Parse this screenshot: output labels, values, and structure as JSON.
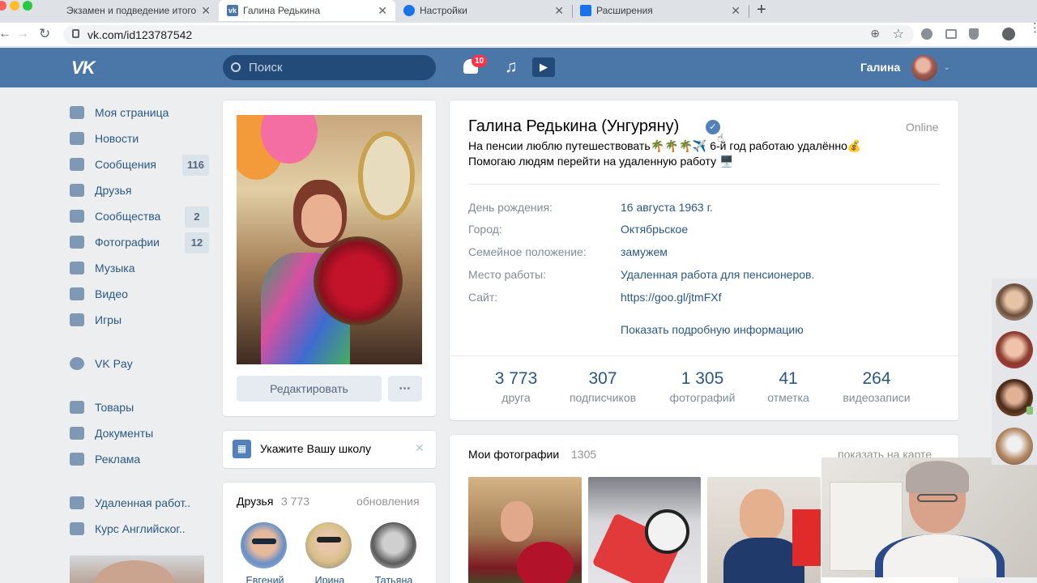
{
  "browser": {
    "tabs": [
      {
        "label": "Экзамен и подведение итогов"
      },
      {
        "label": "Галина Редькина"
      },
      {
        "label": "Настройки"
      },
      {
        "label": "Расширения"
      }
    ],
    "new_tab": "+",
    "url": "vk.com/id123787542"
  },
  "header": {
    "search_placeholder": "Поиск",
    "notifications": "10",
    "user_name": "Галина"
  },
  "menu": [
    {
      "label": "Моя страница",
      "icon": "home-icon"
    },
    {
      "label": "Новости",
      "icon": "news-icon"
    },
    {
      "label": "Сообщения",
      "icon": "messages-icon",
      "count": "116"
    },
    {
      "label": "Друзья",
      "icon": "friends-icon"
    },
    {
      "label": "Сообщества",
      "icon": "groups-icon",
      "count": "2"
    },
    {
      "label": "Фотографии",
      "icon": "camera-icon",
      "count": "12"
    },
    {
      "label": "Музыка",
      "icon": "music-icon"
    },
    {
      "label": "Видео",
      "icon": "video-icon"
    },
    {
      "label": "Игры",
      "icon": "games-icon"
    }
  ],
  "menu2": [
    {
      "label": "VK Pay",
      "icon": "vkpay-icon"
    }
  ],
  "menu3": [
    {
      "label": "Товары",
      "icon": "goods-icon"
    },
    {
      "label": "Документы",
      "icon": "docs-icon"
    },
    {
      "label": "Реклама",
      "icon": "ads-icon"
    }
  ],
  "menu4": [
    {
      "label": "Удаленная работ..",
      "icon": "group-icon"
    },
    {
      "label": "Курс Английског..",
      "icon": "group-icon"
    }
  ],
  "profile": {
    "edit_button": "Редактировать",
    "more_button": "•••",
    "school_prompt": "Укажите Вашу школу",
    "name": "Галина Редькина (Унгуряну)",
    "status_online": "Online",
    "status_line1": "На пенсии люблю путешествовать🌴🌴🌴✈️ 6-й год работаю удалённо💰",
    "status_line2": "Помогаю людям перейти на удаленную работу 🖥️",
    "info": [
      {
        "label": "День рождения:",
        "value": "16 августа 1963 г."
      },
      {
        "label": "Город:",
        "value": "Октябрьское"
      },
      {
        "label": "Семейное положение:",
        "value": "замужем"
      },
      {
        "label": "Место работы:",
        "value": "Удаленная работа для пенсионеров."
      },
      {
        "label": "Сайт:",
        "value": "https://goo.gl/jtmFXf"
      }
    ],
    "more_info": "Показать подробную информацию",
    "stats": [
      {
        "n": "3 773",
        "t": "друга"
      },
      {
        "n": "307",
        "t": "подписчиков"
      },
      {
        "n": "1 305",
        "t": "фотографий"
      },
      {
        "n": "41",
        "t": "отметка"
      },
      {
        "n": "264",
        "t": "видеозаписи"
      }
    ]
  },
  "friends": {
    "title": "Друзья",
    "count": "3 773",
    "updates": "обновления",
    "names": [
      "Евгений",
      "Ирина",
      "Татьяна"
    ]
  },
  "photos": {
    "title": "Мои фотографии",
    "count": "1305",
    "map_link": "показать на карте"
  },
  "colors": {
    "vk_blue": "#4a76a8",
    "link": "#2a5885",
    "muted": "#818c99"
  }
}
